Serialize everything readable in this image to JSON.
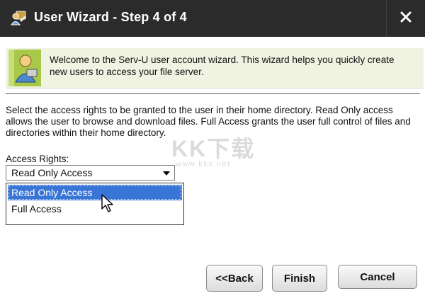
{
  "window": {
    "title": "User Wizard - Step 4 of 4",
    "close_label": "×"
  },
  "banner": {
    "text": "Welcome to the Serv-U user account wizard. This wizard helps you quickly create new users to access your file server."
  },
  "description": "Select the access rights to be granted to the user in their home directory. Read Only access allows the user to browse and download files. Full Access grants the user full control of files and directories within their home directory.",
  "access_rights": {
    "label": "Access Rights:",
    "selected": "Read Only Access",
    "options": [
      "Read Only Access",
      "Full Access"
    ]
  },
  "buttons": {
    "back": "<<Back",
    "finish": "Finish",
    "cancel": "Cancel"
  },
  "watermark": {
    "big": "KK下载",
    "small": "www.kkx.net"
  },
  "colors": {
    "titlebar": "#2b2b2b",
    "banner_bg": "#f1f3e2",
    "selection": "#3875d7"
  }
}
